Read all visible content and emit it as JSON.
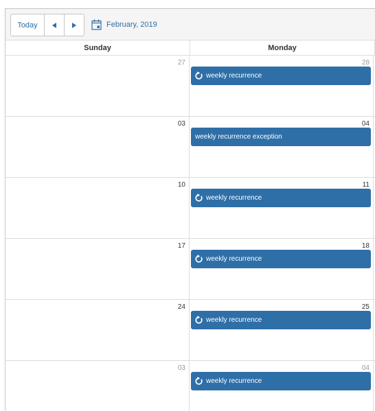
{
  "toolbar": {
    "today_label": "Today",
    "date_label": "February, 2019"
  },
  "headers": [
    "Sunday",
    "Monday"
  ],
  "weeks": [
    {
      "sunday": "27",
      "monday": "28",
      "sunday_other_month": true,
      "monday_other_month": true,
      "event": {
        "title": "weekly recurrence",
        "icon": "recurrence-icon"
      }
    },
    {
      "sunday": "03",
      "monday": "04",
      "sunday_other_month": false,
      "monday_other_month": false,
      "event": {
        "title": "weekly recurrence exception",
        "icon": ""
      }
    },
    {
      "sunday": "10",
      "monday": "11",
      "sunday_other_month": false,
      "monday_other_month": false,
      "event": {
        "title": "weekly recurrence",
        "icon": "recurrence-icon"
      }
    },
    {
      "sunday": "17",
      "monday": "18",
      "sunday_other_month": false,
      "monday_other_month": false,
      "event": {
        "title": "weekly recurrence",
        "icon": "recurrence-icon"
      }
    },
    {
      "sunday": "24",
      "monday": "25",
      "sunday_other_month": false,
      "monday_other_month": false,
      "event": {
        "title": "weekly recurrence",
        "icon": "recurrence-icon"
      }
    },
    {
      "sunday": "03",
      "monday": "04",
      "sunday_other_month": true,
      "monday_other_month": true,
      "event": {
        "title": "weekly recurrence",
        "icon": "recurrence-icon"
      }
    }
  ],
  "colors": {
    "event": "#2f6fa8",
    "link": "#2e6da4",
    "other_month_text": "#999999"
  }
}
